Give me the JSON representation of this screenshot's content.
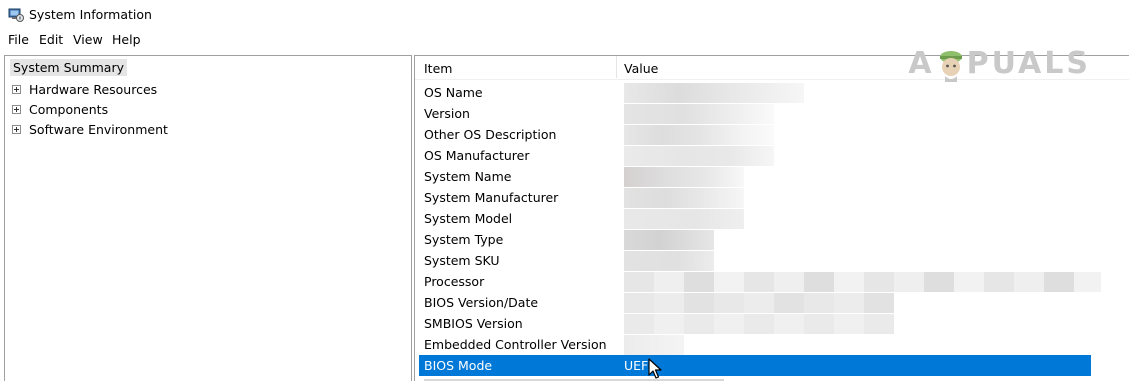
{
  "window": {
    "title": "System Information",
    "icon": "system-info-icon"
  },
  "menu": [
    "File",
    "Edit",
    "View",
    "Help"
  ],
  "tree": {
    "root": "System Summary",
    "children": [
      "Hardware Resources",
      "Components",
      "Software Environment"
    ]
  },
  "list": {
    "columns": [
      "Item",
      "Value"
    ],
    "rows": [
      {
        "item": "OS Name",
        "value": ""
      },
      {
        "item": "Version",
        "value": ""
      },
      {
        "item": "Other OS Description",
        "value": ""
      },
      {
        "item": "OS Manufacturer",
        "value": ""
      },
      {
        "item": "System Name",
        "value": ""
      },
      {
        "item": "System Manufacturer",
        "value": ""
      },
      {
        "item": "System Model",
        "value": ""
      },
      {
        "item": "System Type",
        "value": ""
      },
      {
        "item": "System SKU",
        "value": ""
      },
      {
        "item": "Processor",
        "value": ""
      },
      {
        "item": "BIOS Version/Date",
        "value": ""
      },
      {
        "item": "SMBIOS Version",
        "value": ""
      },
      {
        "item": "Embedded Controller Version",
        "value": ""
      },
      {
        "item": "BIOS Mode",
        "value": "UEFI",
        "selected": true
      }
    ]
  },
  "watermark": {
    "text_a": "A",
    "text_rest": "PUALS"
  },
  "colors": {
    "selection": "#0078d7",
    "tree_root_highlight": "#e5e5e5"
  }
}
